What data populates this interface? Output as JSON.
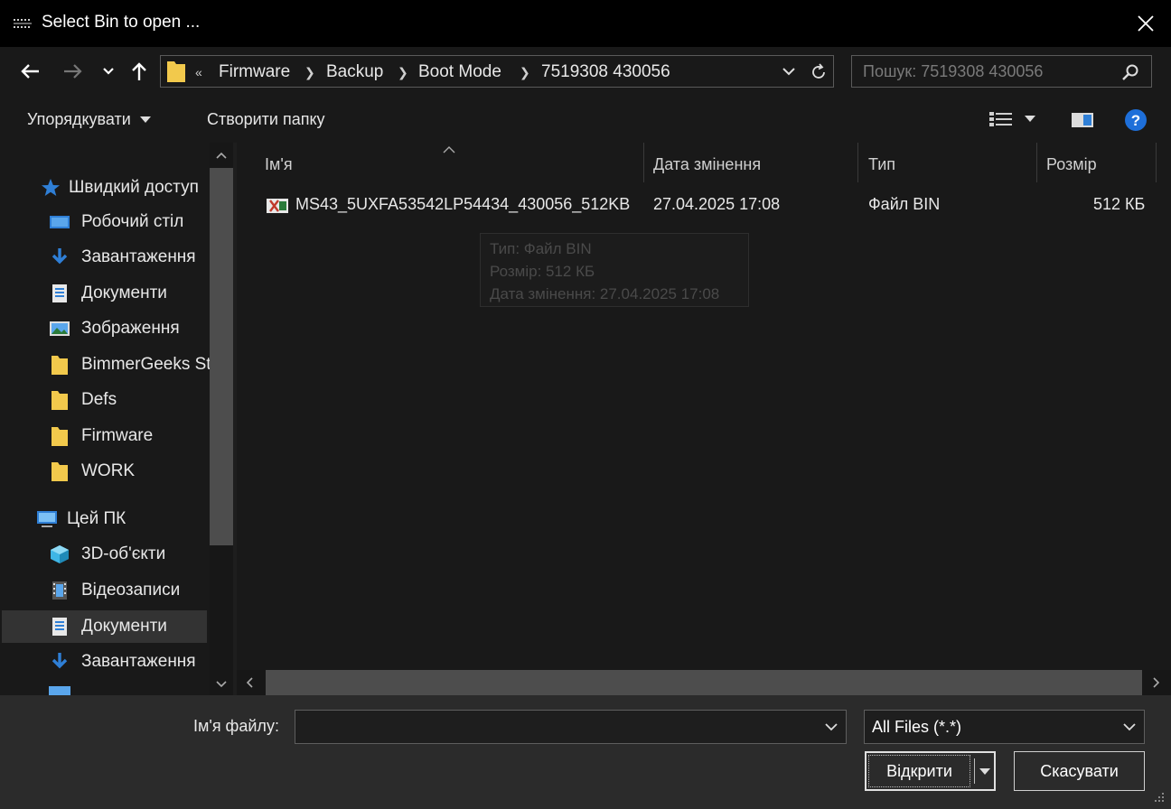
{
  "window": {
    "title": "Select Bin to open ..."
  },
  "address": {
    "overflow": "«",
    "crumbs": [
      "Firmware",
      "Backup",
      "Boot Mode",
      "7519308 430056"
    ]
  },
  "search": {
    "placeholder": "Пошук: 7519308 430056"
  },
  "toolbar": {
    "organize": "Упорядкувати",
    "new_folder": "Створити папку"
  },
  "sidebar": {
    "quick_access": "Швидкий доступ",
    "quick_items": [
      {
        "label": "Робочий стіл",
        "icon": "desktop-icon"
      },
      {
        "label": "Завантаження",
        "icon": "download-icon"
      },
      {
        "label": "Документи",
        "icon": "documents-icon"
      },
      {
        "label": "Зображення",
        "icon": "pictures-icon"
      },
      {
        "label": "BimmerGeeks St",
        "icon": "folder-icon"
      },
      {
        "label": "Defs",
        "icon": "folder-icon"
      },
      {
        "label": "Firmware",
        "icon": "folder-icon"
      },
      {
        "label": "WORK",
        "icon": "folder-icon"
      }
    ],
    "this_pc": "Цей ПК",
    "pc_items": [
      {
        "label": "3D-об'єкти",
        "icon": "cube-icon"
      },
      {
        "label": "Відеозаписи",
        "icon": "video-icon"
      },
      {
        "label": "Документи",
        "icon": "documents-icon"
      },
      {
        "label": "Завантаження",
        "icon": "download-icon"
      }
    ]
  },
  "columns": {
    "name": "Ім'я",
    "date": "Дата змінення",
    "type": "Тип",
    "size": "Розмір"
  },
  "files": [
    {
      "name": "MS43_5UXFA53542LP54434_430056_512KB",
      "date": "27.04.2025 17:08",
      "type": "Файл BIN",
      "size": "512 КБ"
    }
  ],
  "tooltip": {
    "type": "Тип: Файл BIN",
    "size": "Розмір: 512 КБ",
    "date": "Дата змінення: 27.04.2025 17:08"
  },
  "bottom": {
    "filename_label": "Ім'я файлу:",
    "filename_value": "",
    "filter": "All Files (*.*)",
    "open": "Відкрити",
    "cancel": "Скасувати"
  },
  "colors": {
    "folder": "#f2c94c",
    "accent": "#2f7fd6",
    "help": "#1e6fd9"
  }
}
